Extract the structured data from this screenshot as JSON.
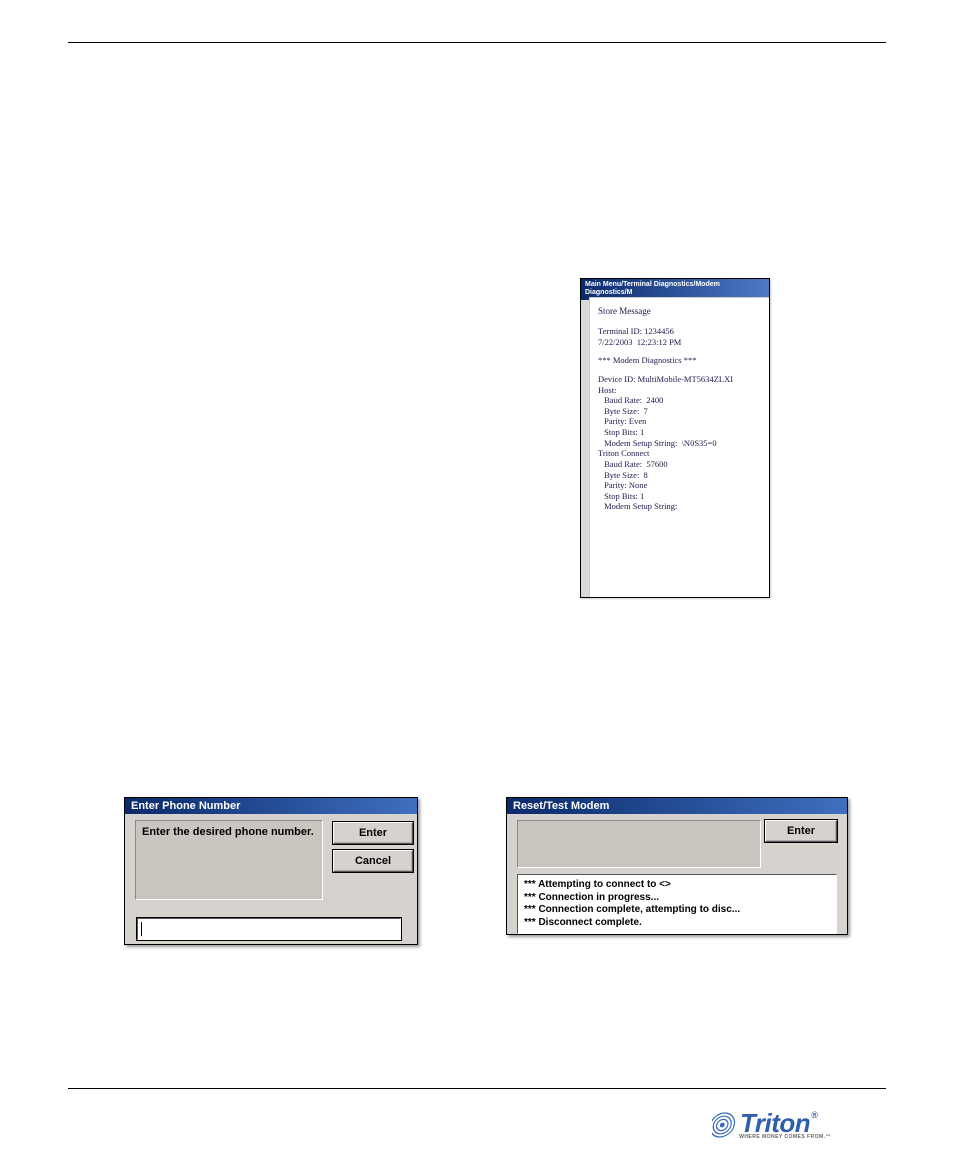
{
  "diag": {
    "titlebar": "Main Menu/Terminal Diagnostics/Modem Diagnostics/M",
    "header": "Store Message",
    "terminal_id_label": "Terminal ID:",
    "terminal_id_value": "1234456",
    "datetime": "7/22/2003  12:23:12 PM",
    "section": "*** Modem Diagnostics ***",
    "device_label": "Device ID:",
    "device_value": "MultiMobile-MT5634ZLXI",
    "host_label": "Host:",
    "host": {
      "baud": " Baud Rate:  2400",
      "byte": " Byte Size:  7",
      "parity": " Parity: Even",
      "stop": " Stop Bits: 1",
      "setup": " Modem Setup String:  \\N0S35=0"
    },
    "triton_label": "Triton Connect",
    "triton": {
      "baud": " Baud Rate:  57600",
      "byte": " Byte Size:  8",
      "parity": " Parity: None",
      "stop": " Stop Bits: 1",
      "setup": " Modem Setup String:"
    }
  },
  "phone_dlg": {
    "title": "Enter Phone Number",
    "prompt": "Enter the desired phone number.",
    "enter": "Enter",
    "cancel": "Cancel",
    "input_value": ""
  },
  "modem_dlg": {
    "title": "Reset/Test Modem",
    "enter": "Enter",
    "log0": "*** Attempting to connect to <>",
    "log1": "*** Connection in progress...",
    "log2": "*** Connection complete, attempting to disc...",
    "log3": "*** Disconnect complete."
  },
  "footer": {
    "brand": "Triton",
    "tag": "WHERE MONEY COMES FROM.™"
  }
}
